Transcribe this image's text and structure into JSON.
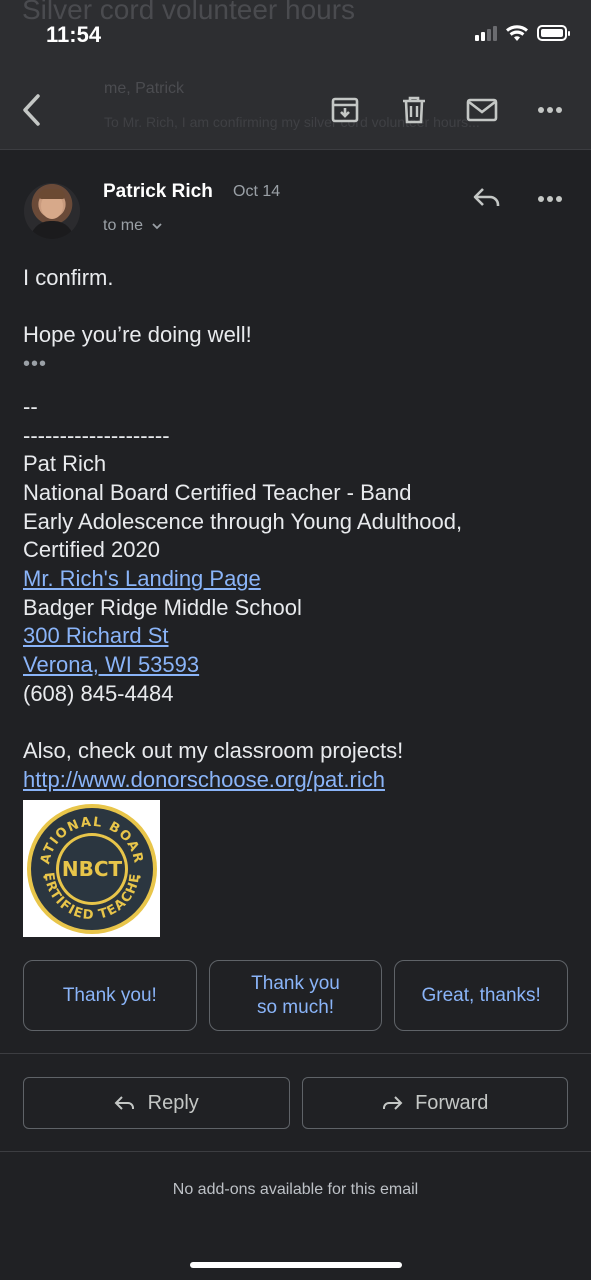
{
  "status_bar": {
    "time": "11:54",
    "background_subject": "Silver cord volunteer hours"
  },
  "toolbar": {
    "background_meta": "me, Patrick",
    "background_preview": "To Mr. Rich, I am confirming my silver cord volunteer hours..."
  },
  "message": {
    "sender": "Patrick Rich",
    "date": "Oct 14",
    "recipient": "to me",
    "body": {
      "line1": "I confirm.",
      "line2": "Hope you’re doing well!",
      "ellipsis": "•••",
      "sig_dash": "--",
      "sig_rule": "--------------------",
      "sig_name": "Pat Rich",
      "sig_title": "National Board Certified Teacher - Band",
      "sig_cert1": "Early Adolescence through Young Adulthood,",
      "sig_cert2": "Certified 2020",
      "sig_link1": "Mr. Rich's Landing Page",
      "sig_school": "Badger Ridge Middle School",
      "sig_addr1": "300 Richard St",
      "sig_addr2": "Verona, WI 53593",
      "sig_phone": "(608) 845-4484",
      "projects_text": "Also, check out my classroom projects!",
      "projects_url": "http://www.donorschoose.org/pat.rich"
    },
    "badge": {
      "center_text": "NBCT",
      "top_arc": "NATIONAL BOARD",
      "bottom_arc": "CERTIFIED TEACHER"
    }
  },
  "smart_replies": [
    {
      "label_line1": "Thank you!",
      "label_line2": ""
    },
    {
      "label_line1": "Thank you",
      "label_line2": "so much!"
    },
    {
      "label_line1": "Great, thanks!",
      "label_line2": ""
    }
  ],
  "actions": {
    "reply_label": "Reply",
    "forward_label": "Forward"
  },
  "footer": {
    "addons_text": "No add-ons available for this email"
  },
  "colors": {
    "background": "#202124",
    "link": "#8ab4f8",
    "badge_gold": "#e8c54a",
    "badge_navy": "#2b3640"
  }
}
